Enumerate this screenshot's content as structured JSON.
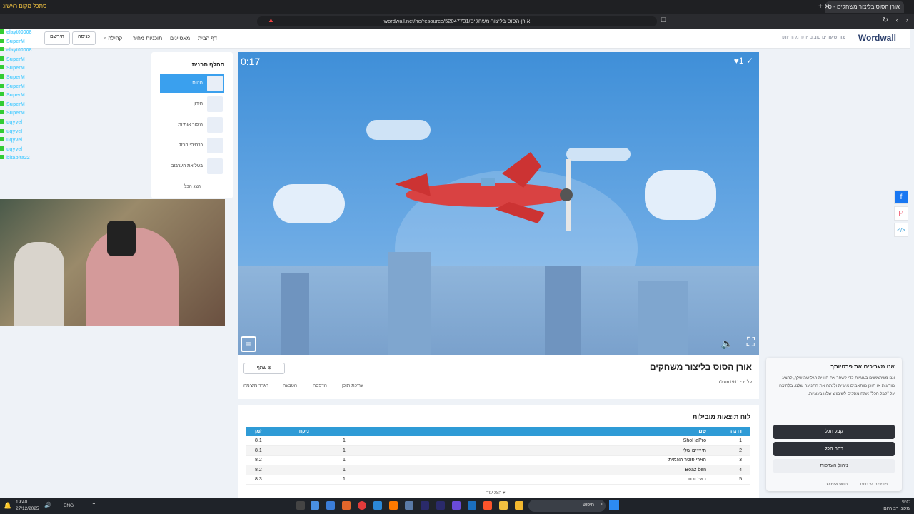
{
  "browser": {
    "tab_title": "אורן הסוס בליצור משחקים - ס",
    "url": "wordwall.net/he/resource/52047731/אורן-הסוס-בליצור-משחקים",
    "stream_title": "סתכל מקום ראשונ"
  },
  "site_header": {
    "logo": "Wordwall",
    "tagline": "צור שיעורים טובים יותר מהר יותר",
    "nav": [
      "דף הבית",
      "מאפיינים",
      "תוכניות מחיר",
      "קהילה"
    ],
    "login_label": "כניסה",
    "signup_label": "הירשם"
  },
  "chat": [
    {
      "user": "elayt00008",
      "text": ""
    },
    {
      "user": "SuperM",
      "text": ""
    },
    {
      "user": "elayt00008",
      "text": ""
    },
    {
      "user": "SuperM",
      "text": ""
    },
    {
      "user": "SuperM",
      "text": ""
    },
    {
      "user": "SuperM",
      "text": ""
    },
    {
      "user": "SuperM",
      "text": ""
    },
    {
      "user": "SuperM",
      "text": ""
    },
    {
      "user": "SuperM",
      "text": ""
    },
    {
      "user": "SuperM",
      "text": ""
    },
    {
      "user": "uqyvel",
      "text": ""
    },
    {
      "user": "uqyvel",
      "text": ""
    },
    {
      "user": "uqyvel",
      "text": ""
    },
    {
      "user": "uqyvel",
      "text": ""
    },
    {
      "user": "bitapita22",
      "text": ""
    }
  ],
  "template_picker": {
    "title": "החלף תבנית",
    "items": [
      {
        "label": "מטוס",
        "active": true
      },
      {
        "label": "חידון",
        "active": false
      },
      {
        "label": "היפוך אותיות",
        "active": false
      },
      {
        "label": "כרטיסי הבזק",
        "active": false
      },
      {
        "label": "בטל את הערבוב",
        "active": false
      }
    ],
    "show_all": "הצג הכל"
  },
  "game": {
    "timer": "0:17",
    "score": "1"
  },
  "activity": {
    "title": "אורן הסוס בליצור משחקים",
    "author": "Oren1911 על ידי",
    "share_label": "שתף",
    "actions": [
      "עריכת תוכן",
      "הדפסה",
      "הטבעה",
      "הגדר משימה"
    ]
  },
  "leaderboard": {
    "title": "לוח תוצאות מובילות",
    "columns": [
      "דרגה",
      "שם",
      "ניקוד",
      "זמן"
    ],
    "rows": [
      {
        "rank": "1",
        "name": "ShoHaPro",
        "score": "1",
        "time": "8.1"
      },
      {
        "rank": "2",
        "name": "חיייייים שלי",
        "score": "1",
        "time": "8.1"
      },
      {
        "rank": "3",
        "name": "הארי פוטר האמיתי",
        "score": "1",
        "time": "8.2"
      },
      {
        "rank": "4",
        "name": "Boaz ben",
        "score": "1",
        "time": "8.2"
      },
      {
        "rank": "5",
        "name": "בועז ובנו",
        "score": "1",
        "time": "8.3"
      }
    ],
    "show_more": "הצג עוד"
  },
  "cookie": {
    "title": "אנו מעריכים את פרטיותך",
    "body": "אנו משתמשים בעוגיות כדי לשפר את חוויית הגלישה שלך, להציג מודעות או תוכן מותאמים אישית ולנתח את התנועה שלנו. בלחיצה על \"קבל הכל\" אתה מסכים לשימוש שלנו בעוגיות.",
    "accept_label": "קבל הכל",
    "reject_label": "דחה הכל",
    "manage_label": "ניהול העדפות",
    "privacy_link": "מדיניות פרטיות",
    "terms_link": "תנאי שימוש"
  },
  "taskbar": {
    "time": "19:40",
    "date": "27/12/2025",
    "lang": "ENG",
    "search_placeholder": "חיפוש",
    "weather": "9°C",
    "weather_desc": "מעונן רב היום"
  },
  "colors": {
    "accent": "#2f9bd6",
    "dark_button": "#2e3138",
    "active_template": "#3aa0ee"
  }
}
